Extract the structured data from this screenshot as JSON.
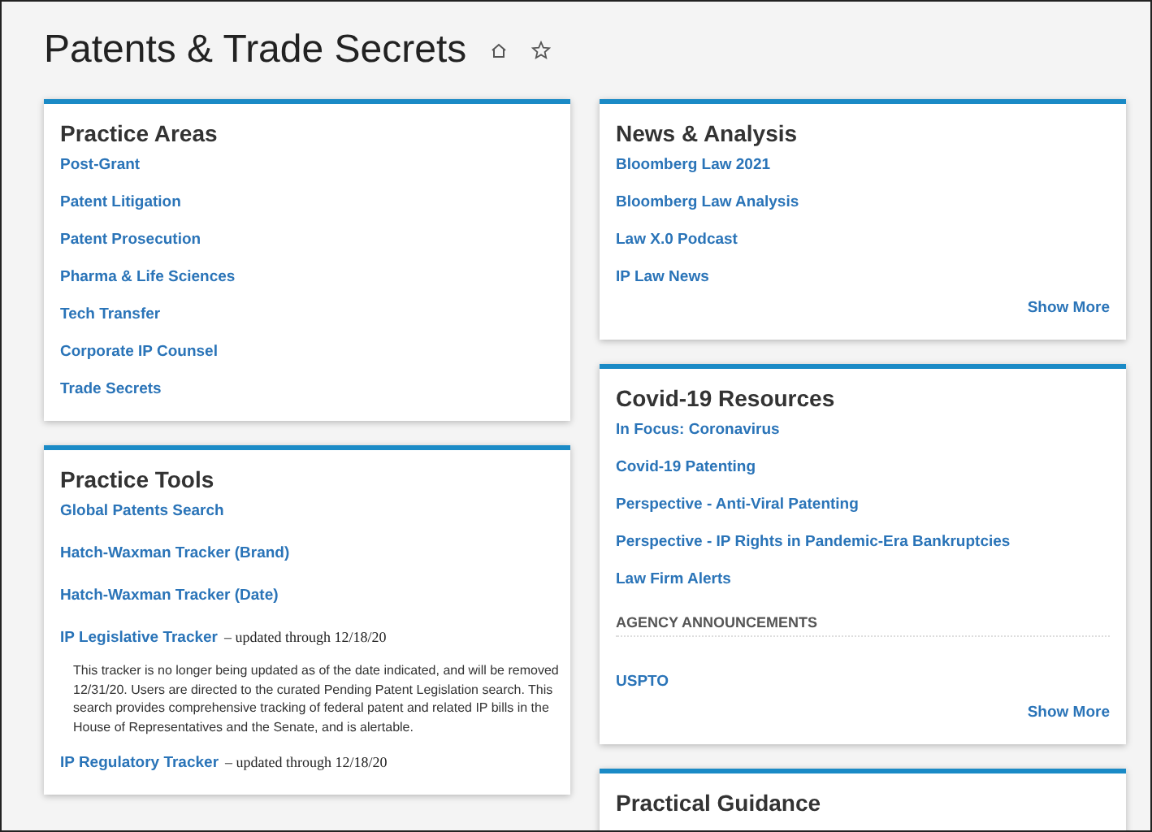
{
  "page": {
    "title": "Patents & Trade Secrets"
  },
  "columns": [
    {
      "cards": [
        {
          "title": "Practice Areas",
          "entries": [
            {
              "kind": "link",
              "label": "Post-Grant"
            },
            {
              "kind": "link",
              "label": "Patent Litigation"
            },
            {
              "kind": "link",
              "label": "Patent Prosecution"
            },
            {
              "kind": "link",
              "label": "Pharma & Life Sciences"
            },
            {
              "kind": "link",
              "label": "Tech Transfer"
            },
            {
              "kind": "link",
              "label": "Corporate IP Counsel"
            },
            {
              "kind": "link",
              "label": "Trade Secrets"
            }
          ]
        },
        {
          "title": "Practice Tools",
          "entries": [
            {
              "kind": "link",
              "label": "Global Patents Search"
            },
            {
              "kind": "link",
              "label": "Hatch-Waxman Tracker (Brand)"
            },
            {
              "kind": "link",
              "label": "Hatch-Waxman Tracker (Date)"
            },
            {
              "kind": "link",
              "label": "IP Legislative Tracker",
              "note": "– updated through 12/18/20",
              "description": "This tracker is no longer being updated as of the date indicated, and will be removed 12/31/20. Users are directed to the curated Pending Patent Legislation search. This search provides comprehensive tracking of federal patent and related IP bills in the House of Representatives and the Senate, and is alertable."
            },
            {
              "kind": "link",
              "label": "IP Regulatory Tracker",
              "note": "– updated through 12/18/20"
            }
          ]
        }
      ]
    },
    {
      "cards": [
        {
          "title": "News & Analysis",
          "entries": [
            {
              "kind": "link",
              "label": "Bloomberg Law 2021"
            },
            {
              "kind": "link",
              "label": "Bloomberg Law Analysis"
            },
            {
              "kind": "link",
              "label": "Law X.0 Podcast"
            },
            {
              "kind": "link",
              "label": "IP Law News"
            }
          ],
          "more": "Show More"
        },
        {
          "title": "Covid-19 Resources",
          "entries": [
            {
              "kind": "link",
              "label": "In Focus: Coronavirus"
            },
            {
              "kind": "link",
              "label": "Covid-19 Patenting"
            },
            {
              "kind": "link",
              "label": "Perspective - Anti-Viral Patenting"
            },
            {
              "kind": "link",
              "label": "Perspective - IP Rights in Pandemic-Era Bankruptcies"
            },
            {
              "kind": "link",
              "label": "Law Firm Alerts"
            },
            {
              "kind": "heading",
              "label": "AGENCY ANNOUNCEMENTS"
            },
            {
              "kind": "link",
              "label": "USPTO"
            }
          ],
          "more": "Show More"
        },
        {
          "title": "Practical Guidance"
        }
      ]
    }
  ]
}
